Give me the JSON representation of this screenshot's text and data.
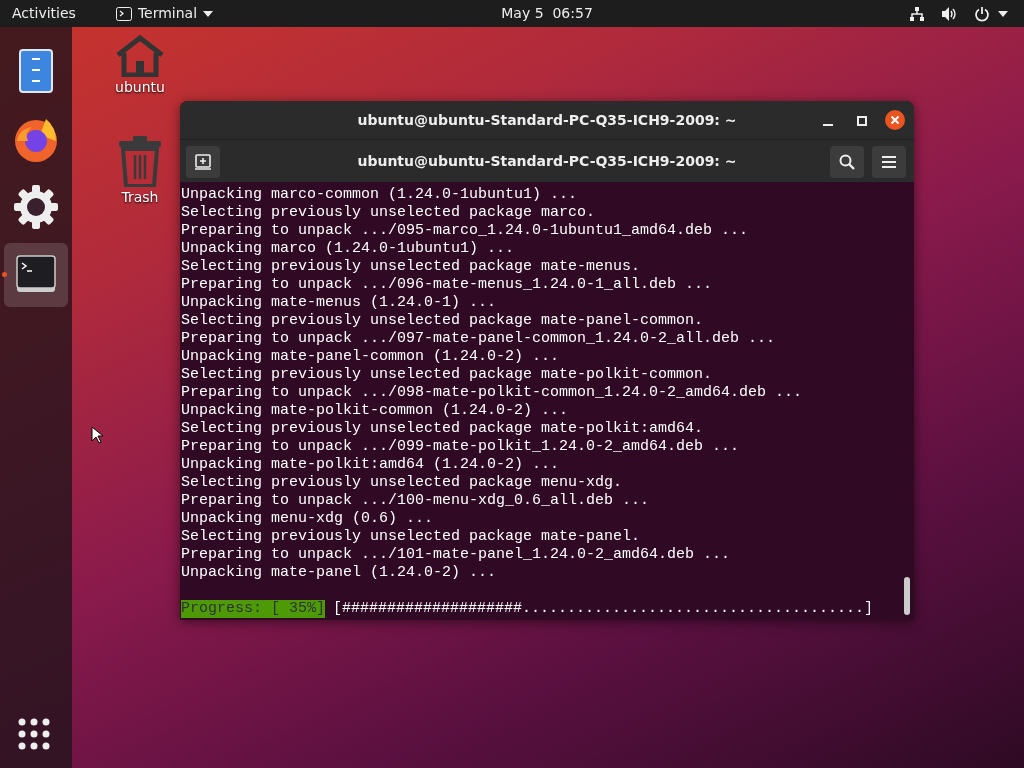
{
  "top_bar": {
    "activities": "Activities",
    "app_menu": "Terminal",
    "clock": "May 5  06:57"
  },
  "dock": {
    "items": [
      {
        "kind": "files",
        "running": false,
        "selected": false
      },
      {
        "kind": "firefox",
        "running": false,
        "selected": false
      },
      {
        "kind": "settings",
        "running": false,
        "selected": false
      },
      {
        "kind": "terminal",
        "running": true,
        "selected": true
      }
    ]
  },
  "desktop_icons": [
    {
      "kind": "home",
      "label": "ubuntu"
    },
    {
      "kind": "trash",
      "label": "Trash"
    }
  ],
  "window": {
    "title": "ubuntu@ubuntu-Standard-PC-Q35-ICH9-2009: ~",
    "tab_title": "ubuntu@ubuntu-Standard-PC-Q35-ICH9-2009: ~",
    "lines": [
      "Unpacking marco-common (1.24.0-1ubuntu1) ...",
      "Selecting previously unselected package marco.",
      "Preparing to unpack .../095-marco_1.24.0-1ubuntu1_amd64.deb ...",
      "Unpacking marco (1.24.0-1ubuntu1) ...",
      "Selecting previously unselected package mate-menus.",
      "Preparing to unpack .../096-mate-menus_1.24.0-1_all.deb ...",
      "Unpacking mate-menus (1.24.0-1) ...",
      "Selecting previously unselected package mate-panel-common.",
      "Preparing to unpack .../097-mate-panel-common_1.24.0-2_all.deb ...",
      "Unpacking mate-panel-common (1.24.0-2) ...",
      "Selecting previously unselected package mate-polkit-common.",
      "Preparing to unpack .../098-mate-polkit-common_1.24.0-2_amd64.deb ...",
      "Unpacking mate-polkit-common (1.24.0-2) ...",
      "Selecting previously unselected package mate-polkit:amd64.",
      "Preparing to unpack .../099-mate-polkit_1.24.0-2_amd64.deb ...",
      "Unpacking mate-polkit:amd64 (1.24.0-2) ...",
      "Selecting previously unselected package menu-xdg.",
      "Preparing to unpack .../100-menu-xdg_0.6_all.deb ...",
      "Unpacking menu-xdg (0.6) ...",
      "Selecting previously unselected package mate-panel.",
      "Preparing to unpack .../101-mate-panel_1.24.0-2_amd64.deb ...",
      "Unpacking mate-panel (1.24.0-2) ..."
    ],
    "progress": {
      "label": "Progress: [ 35%]",
      "bar": "[####################......................................]"
    }
  }
}
